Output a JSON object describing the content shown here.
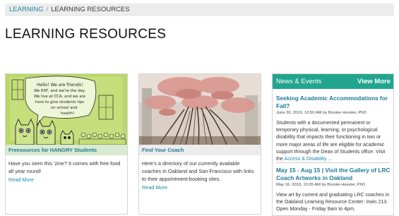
{
  "breadcrumb": {
    "home": "LEARNING",
    "separator": "/",
    "current": "LEARNING RESOURCES"
  },
  "page": {
    "title": "LEARNING RESOURCES"
  },
  "cards": [
    {
      "caption": "Freesources for HANGRY Students",
      "description": "Have you seen this 'zine? It comes with free food all year round!",
      "more": "Read More",
      "image_text": [
        "Hello! We are friends!",
        "We EAT, and we're the day.",
        "We live at CCA, and we are",
        "here to give students tips",
        "on school and",
        "health!"
      ]
    },
    {
      "caption": "Find Your Coach",
      "description": "Here's a directory of our currently available coaches in Oakland and San Francisco with links to their appointment-booking sites.",
      "more": "Read More"
    }
  ],
  "news": {
    "title": "News & Events",
    "view_more": "View More",
    "items": [
      {
        "title": "Seeking Academic Accommodations for Fall?",
        "date": "June 20, 2019, 10:50 AM",
        "byline": "by Brooke Hessler, PhD",
        "body": "Students with a documented permanent or temporary physical, learning, or psychological disability that impacts their functioning in two or more major areas of life are eligible for academic support through the Dean of Students office. Visit the",
        "link": "Access & Disability ..."
      },
      {
        "title": "May 15 - Aug 15 | Visit the Gallery of LRC Coach Artworks in Oakland",
        "date": "May 16, 2019, 10:35 AM",
        "byline": "by Brooke Hessler, PhD",
        "body": "View art by current and graduating LRC coaches in the Oakland Learning Resource Center: Irwin 213. Open Monday - Friday 9am to 4pm."
      }
    ]
  }
}
